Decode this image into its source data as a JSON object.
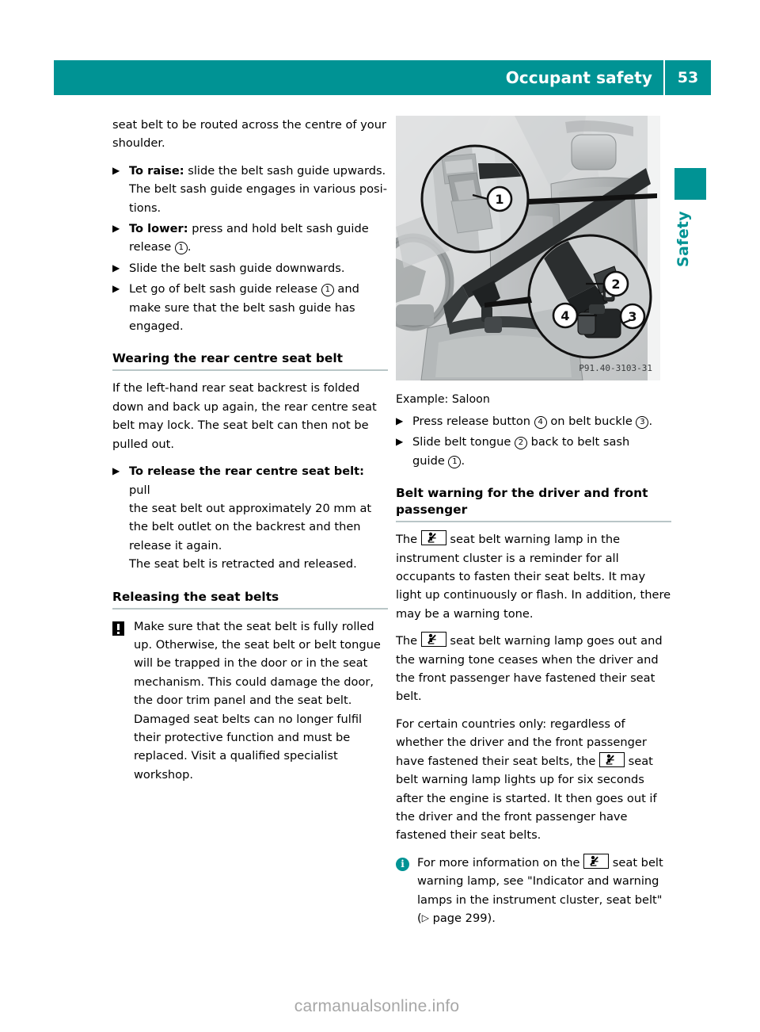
{
  "header": {
    "title": "Occupant safety",
    "page_number": "53",
    "bar_color": "#009394"
  },
  "side_tab": {
    "label": "Safety",
    "color": "#009394"
  },
  "left_column": {
    "intro_paragraph": "seat belt to be routed across the centre of your shoulder.",
    "steps": [
      {
        "bold_lead": "To raise:",
        "text": " slide the belt sash guide upwards.",
        "continuation": "The belt sash guide engages in various posi-tions."
      },
      {
        "bold_lead": "To lower:",
        "text": " press and hold belt sash guide",
        "continuation_pre": "release ",
        "callout": "1",
        "continuation_post": "."
      },
      {
        "bold_lead": "",
        "text": "Slide the belt sash guide downwards."
      },
      {
        "bold_lead": "",
        "text_pre": "Let go of belt sash guide release ",
        "callout": "1",
        "text_post": " and",
        "continuation": "make sure that the belt sash guide has engaged."
      }
    ],
    "heading_wearing": "Wearing the rear centre seat belt",
    "wearing_paragraph": "If the left-hand rear seat backrest is folded down and back up again, the rear centre seat belt may lock. The seat belt can then not be pulled out.",
    "release_step": {
      "bold_lead": "To release the rear centre seat belt:",
      "text": " pull",
      "continuation": "the seat belt out approximately 20 mm at the belt outlet on the backrest and then release it again.",
      "continuation2": "The seat belt is retracted and released."
    },
    "heading_releasing": "Releasing the seat belts",
    "warning_note": "Make sure that the seat belt is fully rolled up. Otherwise, the seat belt or belt tongue will be trapped in the door or in the seat mechanism. This could damage the door, the door trim panel and the seat belt. Damaged seat belts can no longer fulfil their protective function and must be replaced. Visit a qualified specialist workshop."
  },
  "figure": {
    "caption": "Example: Saloon",
    "image_code": "P91.40-3103-31",
    "callouts": [
      "1",
      "2",
      "3",
      "4"
    ],
    "description": "Grayscale illustration of a saloon car interior showing the seat belt with magnified detail circles on the belt sash guide and the belt buckle assembly."
  },
  "right_column": {
    "steps": [
      {
        "text_pre": "Press release button ",
        "callout_a": "4",
        "text_mid": " on belt buckle ",
        "callout_b": "3",
        "text_post": "."
      },
      {
        "text_pre": "Slide belt tongue ",
        "callout_a": "2",
        "text_mid": " back to belt sash",
        "continuation_pre": "guide ",
        "callout_b": "1",
        "continuation_post": "."
      }
    ],
    "heading_belt_warning": "Belt warning for the driver and front passenger",
    "para1_pre": "The ",
    "para1_post": " seat belt warning lamp in the instrument cluster is a reminder for all occupants to fasten their seat belts. It may light up continuously or flash. In addition, there may be a warning tone.",
    "para2_pre": "The ",
    "para2_post": " seat belt warning lamp goes out and the warning tone ceases when the driver and the front passenger have fastened their seat belt.",
    "para3_pre": "For certain countries only: regardless of whether the driver and the front passenger have fastened their seat belts, the ",
    "para3_post": " seat belt warning lamp lights up for six seconds after the engine is started. It then goes out if the driver and the front passenger have fastened their seat belts.",
    "info_note_pre": "For more information on the ",
    "info_note_post": " seat belt warning lamp, see \"Indicator and warning lamps in the instrument cluster, seat belt\" (",
    "info_note_ref": " page 299).",
    "info_color": "#009394"
  },
  "footer": {
    "watermark": "carmanualsonline.info"
  },
  "icons": {
    "bullet_marker": "▶",
    "page_ref_triangle": "▷",
    "warning_symbol": "exclamation-in-black-square",
    "info_symbol": "i-in-teal-circle",
    "lamp_symbol": "seat-belt-warning-lamp"
  }
}
